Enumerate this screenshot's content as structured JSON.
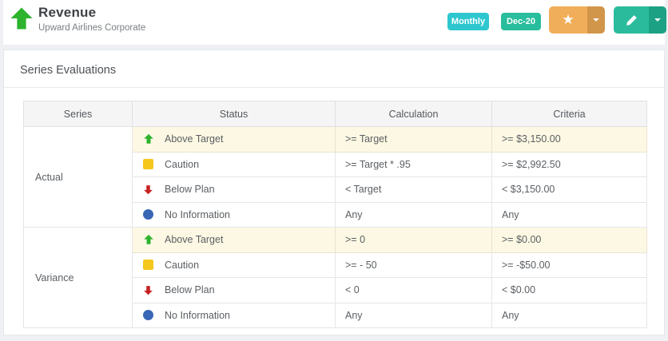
{
  "header": {
    "title": "Revenue",
    "subtitle": "Upward Airlines Corporate",
    "icon": "up-arrow-icon",
    "buttons": {
      "frequency": "Monthly",
      "period": "Dec-20",
      "favorite_icon": "star-icon",
      "edit_icon": "pencil-icon"
    }
  },
  "panel": {
    "title": "Series Evaluations"
  },
  "table": {
    "headers": [
      "Series",
      "Status",
      "Calculation",
      "Criteria"
    ],
    "groups": [
      {
        "series": "Actual",
        "rows": [
          {
            "icon": "up-arrow-icon",
            "status": "Above Target",
            "calculation": ">= Target",
            "criteria": ">= $3,150.00",
            "highlight": true
          },
          {
            "icon": "square-icon",
            "status": "Caution",
            "calculation": ">= Target * .95",
            "criteria": ">= $2,992.50",
            "highlight": false
          },
          {
            "icon": "down-arrow-icon",
            "status": "Below Plan",
            "calculation": "< Target",
            "criteria": "< $3,150.00",
            "highlight": false
          },
          {
            "icon": "circle-icon",
            "status": "No Information",
            "calculation": "Any",
            "criteria": "Any",
            "highlight": false
          }
        ]
      },
      {
        "series": "Variance",
        "rows": [
          {
            "icon": "up-arrow-icon",
            "status": "Above Target",
            "calculation": ">= 0",
            "criteria": ">= $0.00",
            "highlight": true
          },
          {
            "icon": "square-icon",
            "status": "Caution",
            "calculation": ">= - 50",
            "criteria": ">= -$50.00",
            "highlight": false
          },
          {
            "icon": "down-arrow-icon",
            "status": "Below Plan",
            "calculation": "< 0",
            "criteria": "< $0.00",
            "highlight": false
          },
          {
            "icon": "circle-icon",
            "status": "No Information",
            "calculation": "Any",
            "criteria": "Any",
            "highlight": false
          }
        ]
      }
    ]
  },
  "colors": {
    "page_background": "#eef0f3",
    "panel_background": "#ffffff",
    "frequency_button": "#2ec7cf",
    "period_button": "#28bd9c",
    "favorite_button": "#f1ae5a",
    "favorite_button_dark": "#d1964a",
    "edit_button": "#2abb9d",
    "edit_button_dark": "#1ca185",
    "status_green": "#2db32d",
    "status_yellow": "#f5c71c",
    "status_red": "#c62222",
    "status_blue": "#3a67b5",
    "highlight_row": "#fcf8e3",
    "header_row_background": "#f5f5f6"
  }
}
